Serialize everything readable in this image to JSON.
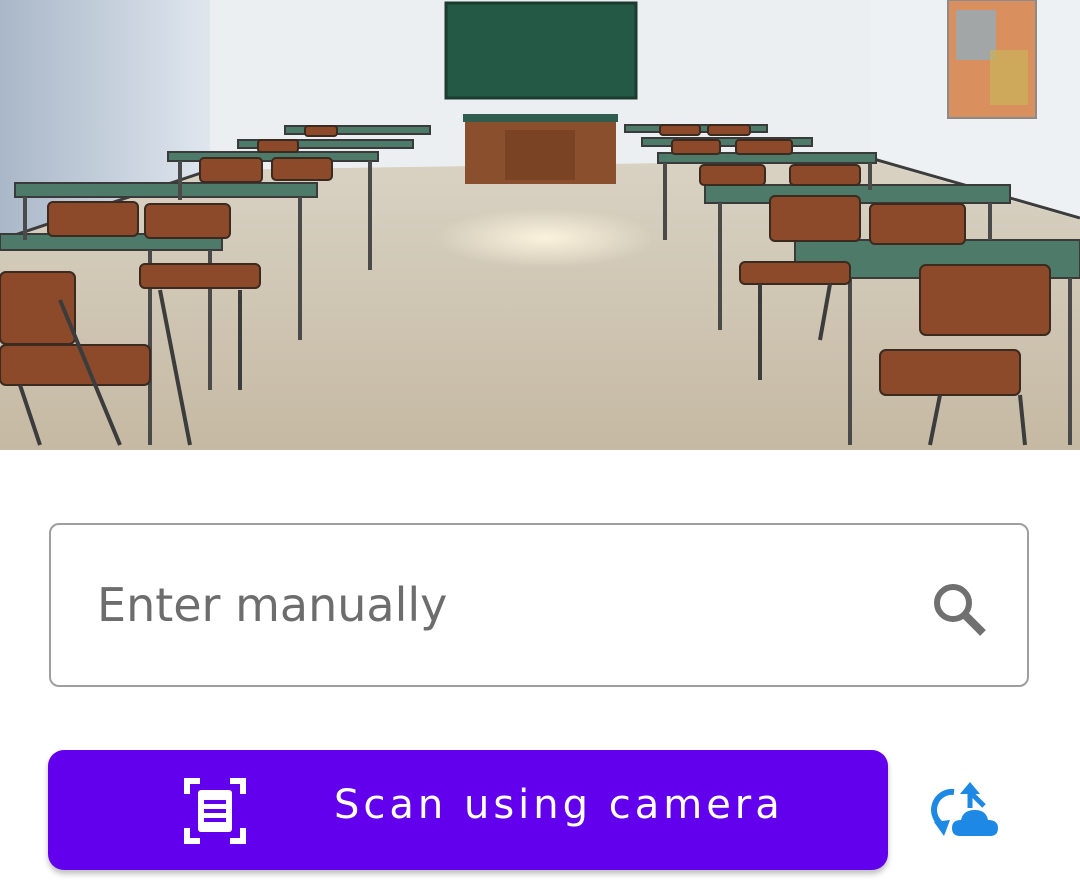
{
  "hero": {
    "image_subject": "empty classroom with desks, chairs, chalkboard and teacher's desk"
  },
  "manual_entry": {
    "placeholder": "Enter manually",
    "value": "",
    "icon": "search-icon"
  },
  "scan_button": {
    "label": "Scan using camera",
    "icon": "document-scan-icon",
    "background_color": "#6200ee"
  },
  "sync_button": {
    "icon": "cloud-sync-icon",
    "color": "#1e88e5"
  },
  "colors": {
    "accent": "#6200ee",
    "field_border": "#9e9e9e",
    "placeholder_text": "#6d6d6d",
    "icon_gray": "#707070"
  }
}
